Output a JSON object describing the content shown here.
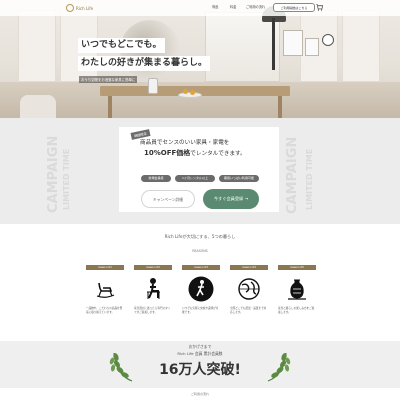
{
  "header": {
    "logo_text": "Rich Life",
    "nav": [
      "商品",
      "料金",
      "ご利用の流れ"
    ],
    "cta_label": "ご利用開始はこちら",
    "cart_icon": "cart-icon"
  },
  "hero": {
    "line1": "いつでもどこでも。",
    "line2": "わたしの好きが集まる暮らし。",
    "sub": "おうち空間をお洒落な家具に簡単に"
  },
  "campaign": {
    "side_text_1": "LIMITED TIME",
    "side_text_2": "CAMPAIGN",
    "badge": "期間限定",
    "line1": "商品員でセンスのいい家具・家電を",
    "line2_pre": "",
    "line2_emph": "10%OFF価格",
    "line2_post": "でレンタルできます。",
    "pills": [
      "新規会員様",
      "1ヶ月レンタル以上",
      "期間いっぱい利用可能"
    ],
    "secondary_button": "キャンペーン詳細",
    "primary_button": "今すぐ会員登録 →"
  },
  "features": {
    "heading": "Rich Lifeが大切にする、5つの暮らし",
    "subheading": "REASONS",
    "items": [
      {
        "label": "reason 01",
        "icon": "rocking-chair-icon",
        "desc": "一品物や、こだわりの商品を豊富に取り揃えています。"
      },
      {
        "label": "reason 02",
        "icon": "person-sitting-icon",
        "desc": "家具選びに迷ったら専門スタッフがご提案します。"
      },
      {
        "label": "reason 03",
        "icon": "person-walking-icon",
        "desc": "いつでも気軽に交換や返却が可能です。"
      },
      {
        "label": "reason 04",
        "icon": "globe-icon",
        "desc": "全国どこでも配送・設置まで対応します。"
      },
      {
        "label": "reason 05",
        "icon": "vase-icon",
        "desc": "家具と暮らしの楽しみ方をご提案します。"
      }
    ]
  },
  "banner": {
    "line1": "おかげさまで",
    "line2": "Rich Life 会員 累計会員数",
    "big": "16万人突破!"
  },
  "footer_hint": "ご利用の流れ"
}
